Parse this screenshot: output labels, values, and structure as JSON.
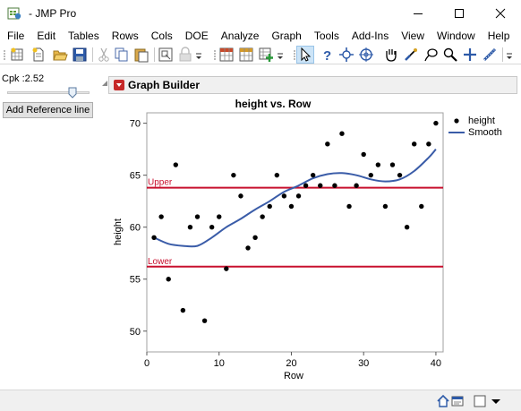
{
  "window": {
    "title": "- JMP Pro"
  },
  "menu": [
    "File",
    "Edit",
    "Tables",
    "Rows",
    "Cols",
    "DOE",
    "Analyze",
    "Graph",
    "Tools",
    "Add-Ins",
    "View",
    "Window",
    "Help"
  ],
  "left_panel": {
    "cpk_label": "Cpk :2.52",
    "slider_fraction": 0.79,
    "ref_button_label": "Add Reference line"
  },
  "graph_builder": {
    "header_title": "Graph Builder"
  },
  "chart_data": {
    "type": "scatter",
    "title": "height vs. Row",
    "xlabel": "Row",
    "ylabel": "height",
    "xlim": [
      0,
      41
    ],
    "ylim": [
      48,
      71
    ],
    "x_ticks": [
      0,
      10,
      20,
      30,
      40
    ],
    "y_ticks": [
      50,
      55,
      60,
      65,
      70
    ],
    "grid": false,
    "legend": {
      "placement": "right",
      "entries": [
        {
          "label": "height",
          "kind": "point"
        },
        {
          "label": "Smooth",
          "kind": "line"
        }
      ]
    },
    "series": [
      {
        "name": "height",
        "x": [
          1,
          2,
          3,
          4,
          5,
          6,
          7,
          8,
          9,
          10,
          11,
          12,
          13,
          14,
          15,
          16,
          17,
          18,
          19,
          20,
          21,
          22,
          23,
          24,
          25,
          26,
          27,
          28,
          29,
          30,
          31,
          32,
          33,
          34,
          35,
          36,
          37,
          38,
          39,
          40
        ],
        "y": [
          59,
          61,
          55,
          66,
          52,
          60,
          61,
          51,
          60,
          61,
          56,
          65,
          63,
          58,
          59,
          61,
          62,
          65,
          63,
          62,
          63,
          64,
          65,
          64,
          68,
          64,
          69,
          62,
          64,
          67,
          65,
          66,
          62,
          66,
          65,
          60,
          68,
          62,
          68,
          70
        ]
      }
    ],
    "smooth": {
      "name": "Smooth",
      "x": [
        1,
        3,
        5,
        7,
        9,
        11,
        13,
        15,
        17,
        19,
        21,
        23,
        25,
        27,
        29,
        31,
        33,
        35,
        37,
        39,
        40
      ],
      "y": [
        59.0,
        58.4,
        58.2,
        58.2,
        59.0,
        60.0,
        60.8,
        61.7,
        62.5,
        63.4,
        64.0,
        64.7,
        65.1,
        65.2,
        65.0,
        64.6,
        64.4,
        64.6,
        65.4,
        66.7,
        67.5
      ]
    },
    "reference_lines": [
      {
        "label": "Upper",
        "value": 63.8
      },
      {
        "label": "Lower",
        "value": 56.2
      }
    ],
    "colors": {
      "points": "#000000",
      "smooth": "#3a5ca8",
      "reference": "#c8102e"
    }
  }
}
